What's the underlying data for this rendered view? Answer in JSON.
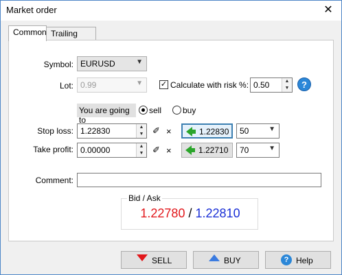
{
  "window": {
    "title": "Market order",
    "close": "✕"
  },
  "tabs": [
    {
      "label": "Common",
      "active": true
    },
    {
      "label": "Trailing stop",
      "active": false
    }
  ],
  "form": {
    "symbol_label": "Symbol:",
    "symbol_value": "EURUSD",
    "lot_label": "Lot:",
    "lot_value": "0.99",
    "risk_checkbox_label": "Calculate with risk %:",
    "risk_checked": "✓",
    "risk_value": "0.50",
    "help_glyph": "?",
    "going_to_label": "You are going to",
    "sell_label": "sell",
    "buy_label": "buy",
    "stop_loss_label": "Stop loss:",
    "stop_loss_value": "1.22830",
    "stop_loss_price_button": "1.22830",
    "stop_loss_points": "50",
    "take_profit_label": "Take profit:",
    "take_profit_value": "0.00000",
    "take_profit_price_button": "1.22710",
    "take_profit_points": "70",
    "comment_label": "Comment:",
    "comment_value": ""
  },
  "quotes": {
    "caption": "Bid / Ask",
    "bid": "1.22780",
    "separator": "/",
    "ask": "1.22810"
  },
  "buttons": {
    "sell": "SELL",
    "buy": "BUY",
    "help": "Help"
  },
  "colors": {
    "bid": "#e2171b",
    "ask": "#1a2fd6",
    "accent": "#2b87d8"
  }
}
